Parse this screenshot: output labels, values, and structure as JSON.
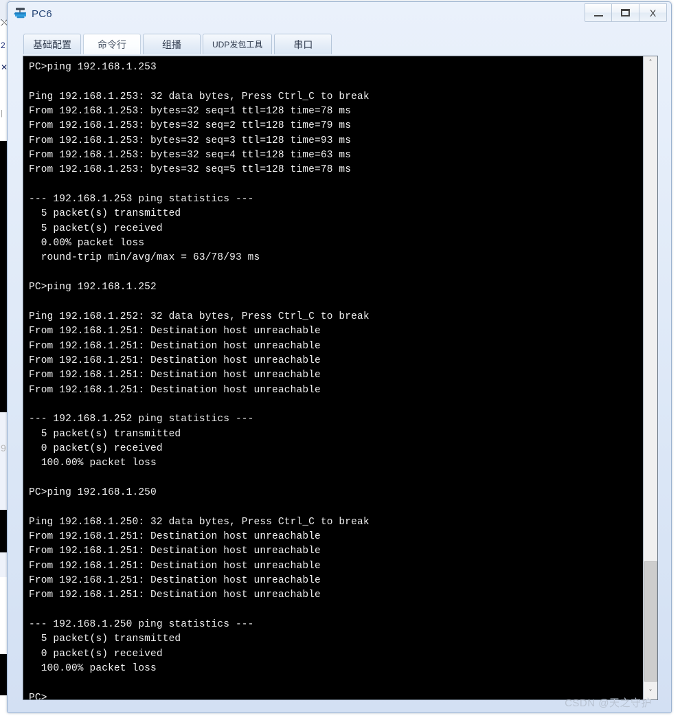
{
  "window": {
    "title": "PC6",
    "icon": "device-pc-icon",
    "buttons": {
      "minimize": "minimize-button",
      "maximize": "maximize-button",
      "close_label": "X"
    }
  },
  "tabs": [
    {
      "label": "基础配置",
      "active": false
    },
    {
      "label": "命令行",
      "active": true
    },
    {
      "label": "组播",
      "active": false
    },
    {
      "label": "UDP发包工具",
      "active": false
    },
    {
      "label": "串口",
      "active": false
    }
  ],
  "terminal": {
    "prompt": "PC>",
    "lines": [
      "PC>ping 192.168.1.253",
      "",
      "Ping 192.168.1.253: 32 data bytes, Press Ctrl_C to break",
      "From 192.168.1.253: bytes=32 seq=1 ttl=128 time=78 ms",
      "From 192.168.1.253: bytes=32 seq=2 ttl=128 time=79 ms",
      "From 192.168.1.253: bytes=32 seq=3 ttl=128 time=93 ms",
      "From 192.168.1.253: bytes=32 seq=4 ttl=128 time=63 ms",
      "From 192.168.1.253: bytes=32 seq=5 ttl=128 time=78 ms",
      "",
      "--- 192.168.1.253 ping statistics ---",
      "  5 packet(s) transmitted",
      "  5 packet(s) received",
      "  0.00% packet loss",
      "  round-trip min/avg/max = 63/78/93 ms",
      "",
      "PC>ping 192.168.1.252",
      "",
      "Ping 192.168.1.252: 32 data bytes, Press Ctrl_C to break",
      "From 192.168.1.251: Destination host unreachable",
      "From 192.168.1.251: Destination host unreachable",
      "From 192.168.1.251: Destination host unreachable",
      "From 192.168.1.251: Destination host unreachable",
      "From 192.168.1.251: Destination host unreachable",
      "",
      "--- 192.168.1.252 ping statistics ---",
      "  5 packet(s) transmitted",
      "  0 packet(s) received",
      "  100.00% packet loss",
      "",
      "PC>ping 192.168.1.250",
      "",
      "Ping 192.168.1.250: 32 data bytes, Press Ctrl_C to break",
      "From 192.168.1.251: Destination host unreachable",
      "From 192.168.1.251: Destination host unreachable",
      "From 192.168.1.251: Destination host unreachable",
      "From 192.168.1.251: Destination host unreachable",
      "From 192.168.1.251: Destination host unreachable",
      "",
      "--- 192.168.1.250 ping statistics ---",
      "  5 packet(s) transmitted",
      "  0 packet(s) received",
      "  100.00% packet loss",
      "",
      "PC>"
    ],
    "background": "#000000",
    "foreground": "#f0f0f0"
  },
  "scrollbar": {
    "up_arrow": "˄",
    "down_arrow": "˅"
  },
  "watermark": "CSDN @天之守护",
  "background_window": {
    "glyph_x": "⤬",
    "glyph_2": "2",
    "glyph_x2": "✕",
    "glyph_bar": "|",
    "glyph_9": "9"
  }
}
